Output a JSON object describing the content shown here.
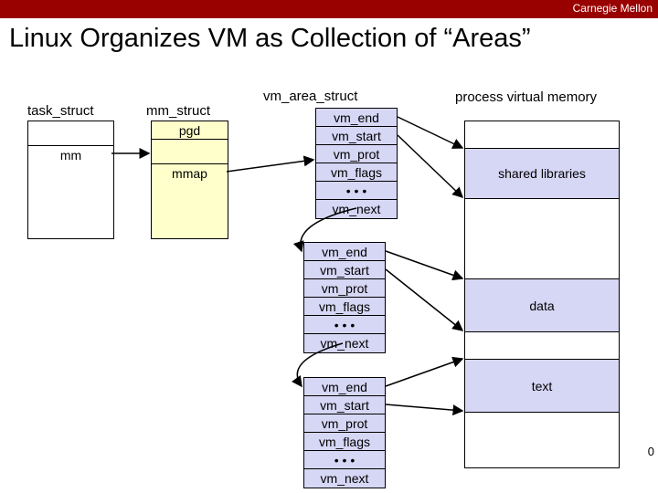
{
  "header": {
    "brand": "Carnegie Mellon"
  },
  "title": "Linux Organizes VM as Collection of “Areas”",
  "labels": {
    "task_struct": "task_struct",
    "mm_struct": "mm_struct",
    "vm_area_struct": "vm_area_struct",
    "pvm": "process virtual memory"
  },
  "task": {
    "mm": "mm"
  },
  "mm": {
    "pgd": "pgd",
    "mmap": "mmap"
  },
  "area": {
    "vm_end": "vm_end",
    "vm_start": "vm_start",
    "vm_prot": "vm_prot",
    "vm_flags": "vm_flags",
    "dots": "• • •",
    "vm_next": "vm_next"
  },
  "mem": {
    "shared": "shared libraries",
    "data": "data",
    "text": "text"
  },
  "slide_number": "0"
}
